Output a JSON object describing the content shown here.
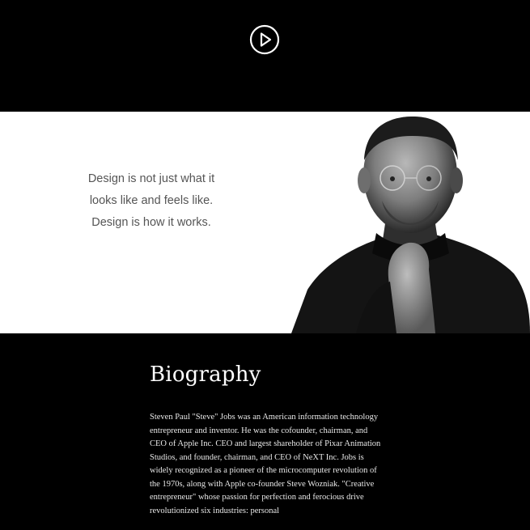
{
  "header": {
    "play_icon": "play-circle-icon"
  },
  "hero": {
    "quote_lines": [
      "Design is not just what it",
      "looks like and feels like.",
      "Design is how it works."
    ]
  },
  "biography": {
    "title": "Biography",
    "text": "Steven Paul \"Steve\" Jobs was an American information technology entrepreneur and inventor. He was the cofounder, chairman, and CEO of Apple Inc. CEO and largest shareholder of Pixar Animation Studios, and founder, chairman, and CEO of NeXT Inc. Jobs is widely recognized as a pioneer of the microcomputer revolution of the 1970s, along with Apple co-founder Steve Wozniak. \"Creative entrepreneur\" whose passion for perfection and ferocious drive revolutionized six industries: personal"
  },
  "colors": {
    "header_bg": "#000000",
    "hero_bg": "#ffffff",
    "quote_text": "#555555",
    "bio_bg": "#000000",
    "bio_text": "#ffffff"
  }
}
